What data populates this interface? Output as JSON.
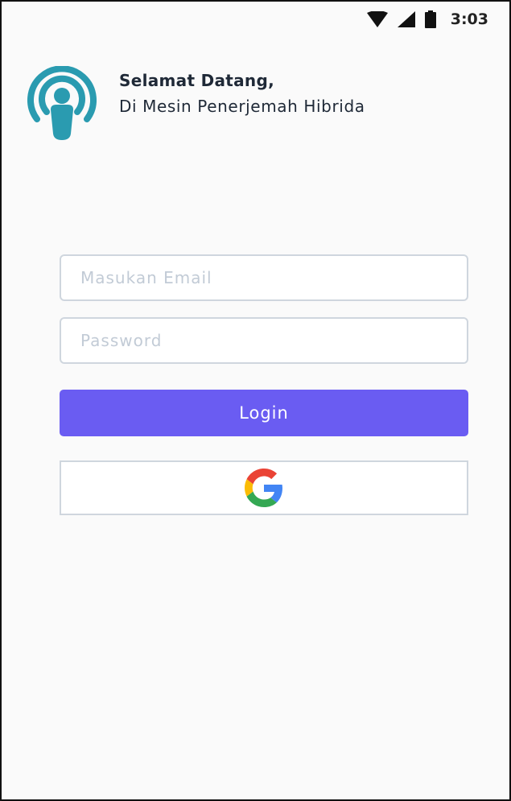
{
  "status_bar": {
    "time": "3:03",
    "icons": [
      "wifi-icon",
      "cellular-signal-icon",
      "battery-icon"
    ]
  },
  "header": {
    "logo_icon": "podcast-broadcast-icon",
    "title": "Selamat Datang,",
    "subtitle": "Di Mesin Penerjemah Hibrida"
  },
  "form": {
    "email": {
      "value": "",
      "placeholder": "Masukan Email"
    },
    "password": {
      "value": "",
      "placeholder": "Password"
    },
    "login_label": "Login",
    "google_icon": "google-logo-icon"
  },
  "colors": {
    "accent": "#6a5cf2",
    "logo": "#2a9bb0",
    "field_border": "#cfd6de",
    "placeholder": "#c2cbd6"
  }
}
